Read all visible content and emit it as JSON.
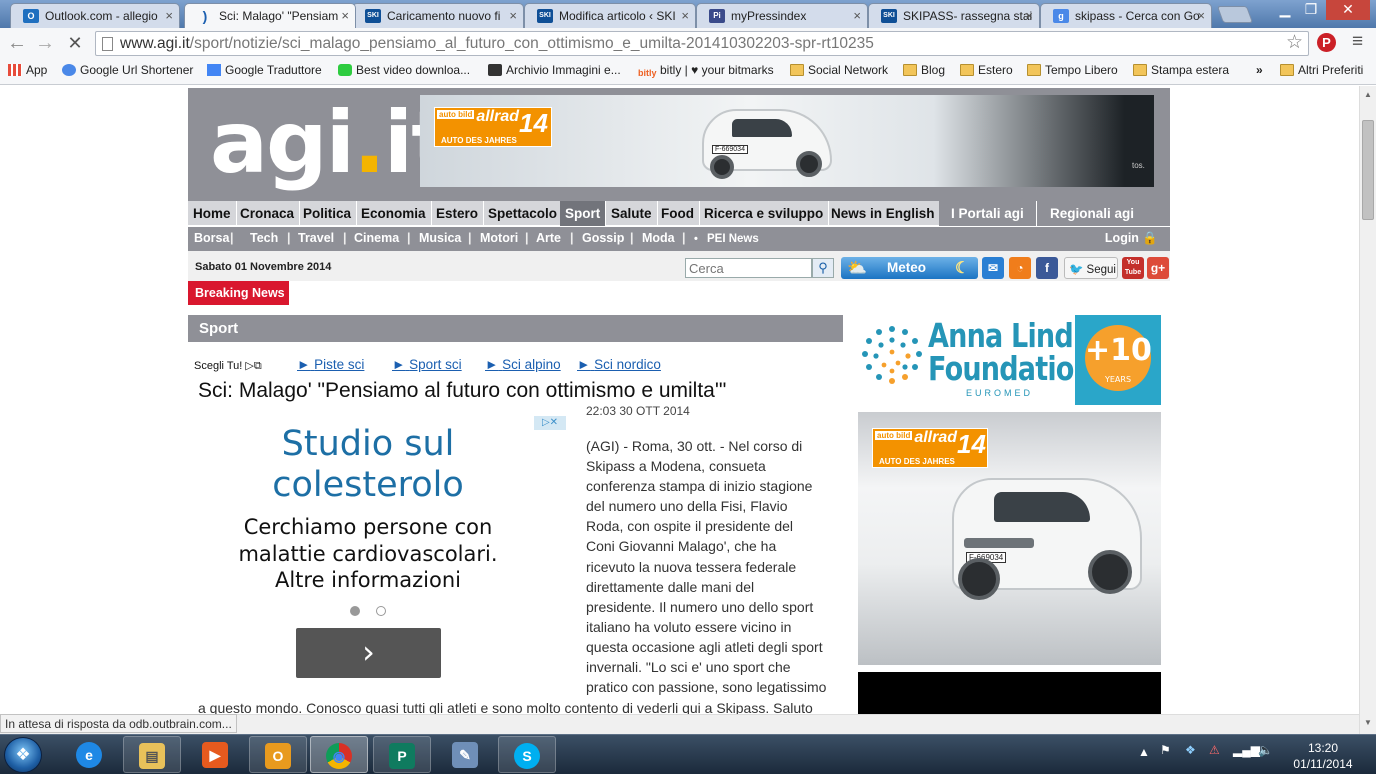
{
  "browser": {
    "tabs": [
      {
        "title": "Outlook.com - allegio",
        "icon_color": "#1f6fbf",
        "icon_text": "O"
      },
      {
        "title": "Sci: Malago' \"Pensiam",
        "icon_color": "#1b5fb0",
        "icon_text": ")"
      },
      {
        "title": "Caricamento nuovo fi",
        "icon_color": "#0f4f96",
        "icon_text": "SKI"
      },
      {
        "title": "Modifica articolo ‹ SKI",
        "icon_color": "#0f4f96",
        "icon_text": "SKI"
      },
      {
        "title": "myPressindex",
        "icon_color": "#3a4a8a",
        "icon_text": "Pi"
      },
      {
        "title": "SKIPASS- rassegna stai",
        "icon_color": "#0f4f96",
        "icon_text": "SKI"
      },
      {
        "title": "skipass - Cerca con Go",
        "icon_color": "#4a88e8",
        "icon_text": "g"
      }
    ],
    "url_host": "www.agi.it",
    "url_path": "/sport/notizie/sci_malago_pensiamo_al_futuro_con_ottimismo_e_umilta-201410302203-spr-rt10235",
    "pinterest_label": "P",
    "bookmarks": [
      {
        "label": "App"
      },
      {
        "label": "Google Url Shortener"
      },
      {
        "label": "Google Traduttore"
      },
      {
        "label": "Best video downloa..."
      },
      {
        "label": "Archivio Immagini e..."
      },
      {
        "label": "bitly | ♥ your bitmarks"
      },
      {
        "label": "Social Network"
      },
      {
        "label": "Blog"
      },
      {
        "label": "Estero"
      },
      {
        "label": "Tempo Libero"
      },
      {
        "label": "Stampa estera"
      },
      {
        "label": "Altri Preferiti"
      }
    ],
    "bookmarks_overflow": "»",
    "status_text": "In attesa di risposta da odb.outbrain.com..."
  },
  "site": {
    "logo_main": "agi",
    "logo_dot": ".",
    "logo_tld": "it",
    "banner": {
      "badge_small": "auto bild",
      "badge_brand": "allrad",
      "badge_year": "14",
      "badge_caption": "AUTO DES JAHRES",
      "plate": "F-669034",
      "edge_text": "tos."
    },
    "main_nav": [
      "Home",
      "Cronaca",
      "Politica",
      "Economia",
      "Estero",
      "Spettacolo",
      "Sport",
      "Salute",
      "Food",
      "Ricerca e sviluppo",
      "News in English",
      "I Portali agi",
      "Regionali agi"
    ],
    "sub_nav": [
      "Borsa",
      "Tech",
      "Travel",
      "Cinema",
      "Musica",
      "Motori",
      "Arte",
      "Gossip",
      "Moda"
    ],
    "sub_nav_extra": "PEI News",
    "login": "Login",
    "date": "Sabato 01 Novembre 2014",
    "search_placeholder": "Cerca",
    "meteo": "Meteo",
    "segui": "Segui",
    "youtube": "You Tube",
    "breaking": "Breaking News",
    "section": "Sport",
    "scegli": "Scegli Tu!",
    "sublinks": [
      "Piste sci",
      "Sport sci",
      "Sci alpino",
      "Sci nordico"
    ],
    "headline": "Sci: Malago' \"Pensiamo al futuro con ottimismo e umilta'\"",
    "dateline": "22:03 30 OTT 2014",
    "article_lines": [
      "(AGI) - Roma, 30 ott. - Nel corso di",
      "Skipass a Modena, consueta",
      "conferenza stampa di inizio stagione",
      "del numero uno della Fisi, Flavio",
      "Roda, con ospite il presidente del",
      "Coni Giovanni Malago', che ha",
      "ricevuto la nuova tessera federale",
      "direttamente dalle mani del",
      "presidente. Il numero uno dello sport",
      "italiano ha voluto essere vicino in",
      "questa occasione agli atleti degli sport",
      "invernali. \"Lo sci e' uno sport che",
      "pratico con passione, sono legatissimo"
    ],
    "article_tail": "a questo mondo. Conosco quasi tutti gli atleti e sono molto contento di vederli qui a Skipass. Saluto",
    "ad": {
      "choices": "▷✕",
      "title_lines": [
        "Studio sul",
        "colesterolo"
      ],
      "text_lines": [
        "Cerchiamo persone con",
        "malattie cardiovascolari.",
        "Altre informazioni"
      ],
      "next": "›"
    },
    "anna_lindh": {
      "name_1": "Anna Lindh",
      "name_2": "Foundation",
      "sub": "EUROMED",
      "badge": "+10",
      "years": "YEARS"
    },
    "side_banner": {
      "badge_small": "auto bild",
      "badge_brand": "allrad",
      "badge_year": "14",
      "badge_caption": "AUTO DES JAHRES",
      "plate": "F-669034"
    }
  },
  "taskbar": {
    "apps": [
      {
        "name": "internet-explorer",
        "icon": "e",
        "color": "#1e88e5"
      },
      {
        "name": "file-explorer",
        "icon": "▤",
        "color": "#e8c15a"
      },
      {
        "name": "media-player",
        "icon": "▶",
        "color": "#e65a1e"
      },
      {
        "name": "outlook",
        "icon": "O",
        "color": "#e89a1e"
      },
      {
        "name": "chrome",
        "icon": "◉",
        "color": "#d93025"
      },
      {
        "name": "publisher",
        "icon": "P",
        "color": "#0f7b5f"
      },
      {
        "name": "paint",
        "icon": "✎",
        "color": "#6f8fb8"
      },
      {
        "name": "skype",
        "icon": "S",
        "color": "#00aff0"
      }
    ],
    "time": "13:20",
    "date": "01/11/2014"
  },
  "colors": {
    "agi_gray": "#8f9097",
    "breaking_red": "#d9172e",
    "link_blue": "#1b5fb0",
    "ad_blue": "#1d6fa5"
  }
}
